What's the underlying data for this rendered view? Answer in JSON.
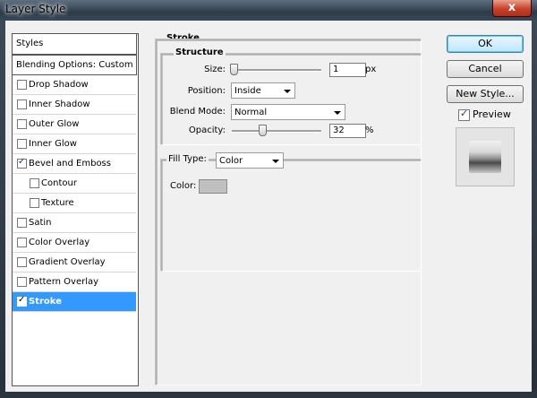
{
  "window": {
    "title": "Layer Style",
    "close_glyph": "x"
  },
  "sidebar": {
    "header": "Styles",
    "blending": "Blending Options: Custom",
    "items": [
      {
        "label": "Drop Shadow",
        "checked": false
      },
      {
        "label": "Inner Shadow",
        "checked": false
      },
      {
        "label": "Outer Glow",
        "checked": false
      },
      {
        "label": "Inner Glow",
        "checked": false
      },
      {
        "label": "Bevel and Emboss",
        "checked": true
      },
      {
        "label": "Contour",
        "checked": false,
        "indent": true
      },
      {
        "label": "Texture",
        "checked": false,
        "indent": true
      },
      {
        "label": "Satin",
        "checked": false
      },
      {
        "label": "Color Overlay",
        "checked": false
      },
      {
        "label": "Gradient Overlay",
        "checked": false
      },
      {
        "label": "Pattern Overlay",
        "checked": false
      },
      {
        "label": "Stroke",
        "checked": true,
        "selected": true
      }
    ]
  },
  "stroke": {
    "title": "Stroke",
    "structure_title": "Structure",
    "size_label": "Size:",
    "size_value": "1",
    "size_unit": "px",
    "position_label": "Position:",
    "position_value": "Inside",
    "blend_label": "Blend Mode:",
    "blend_value": "Normal",
    "opacity_label": "Opacity:",
    "opacity_value": "32",
    "opacity_unit": "%",
    "fill_type_label": "Fill Type:",
    "fill_type_value": "Color",
    "color_label": "Color:",
    "color_swatch": "#c0c0c0"
  },
  "buttons": {
    "ok": "OK",
    "cancel": "Cancel",
    "new_style": "New Style..."
  },
  "preview": {
    "label": "Preview",
    "checked": true
  },
  "colors": {
    "selection": "#3399ff",
    "panel": "#f0f0f0"
  }
}
